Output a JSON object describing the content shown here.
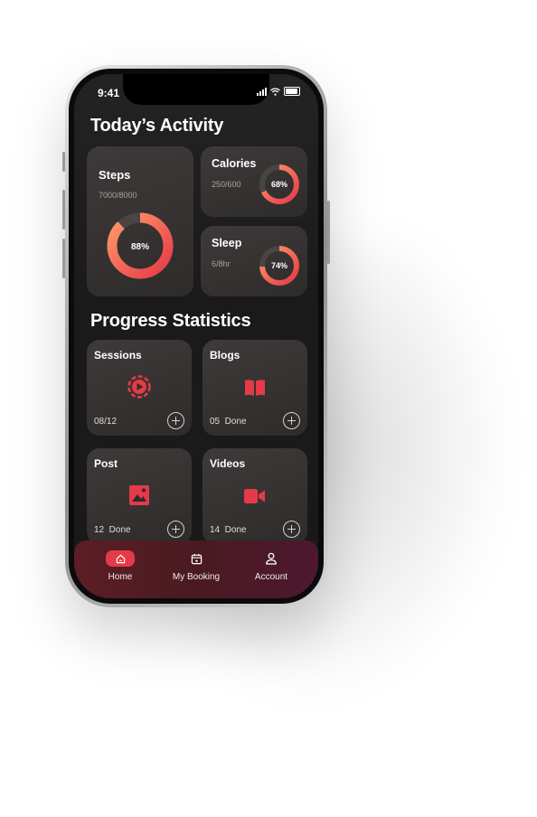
{
  "status_bar": {
    "time": "9:41"
  },
  "activity": {
    "title": "Today’s Activity",
    "steps": {
      "label": "Steps",
      "value": "7000/8000",
      "percent_label": "88%",
      "percent": 0.88
    },
    "calories": {
      "label": "Calories",
      "value": "250/600",
      "percent_label": "68%",
      "percent": 0.68
    },
    "sleep": {
      "label": "Sleep",
      "value": "6/8hr",
      "percent_label": "74%",
      "percent": 0.74
    }
  },
  "progress": {
    "title": "Progress Statistics",
    "cards": [
      {
        "label": "Sessions",
        "footer": "08/12",
        "icon": "play-circle-icon"
      },
      {
        "label": "Blogs",
        "footer": "05  Done",
        "icon": "book-icon"
      },
      {
        "label": "Post",
        "footer": "12  Done",
        "icon": "image-icon"
      },
      {
        "label": "Videos",
        "footer": "14  Done",
        "icon": "video-camera-icon"
      }
    ]
  },
  "nav": {
    "items": [
      {
        "label": "Home",
        "icon": "home-icon",
        "active": true
      },
      {
        "label": "My Booking",
        "icon": "calendar-icon",
        "active": false
      },
      {
        "label": "Account",
        "icon": "user-icon",
        "active": false
      }
    ]
  },
  "colors": {
    "accent": "#e53a47",
    "gradient_start": "#e63946",
    "gradient_end": "#ff9a6b",
    "track": "#4a4545"
  }
}
